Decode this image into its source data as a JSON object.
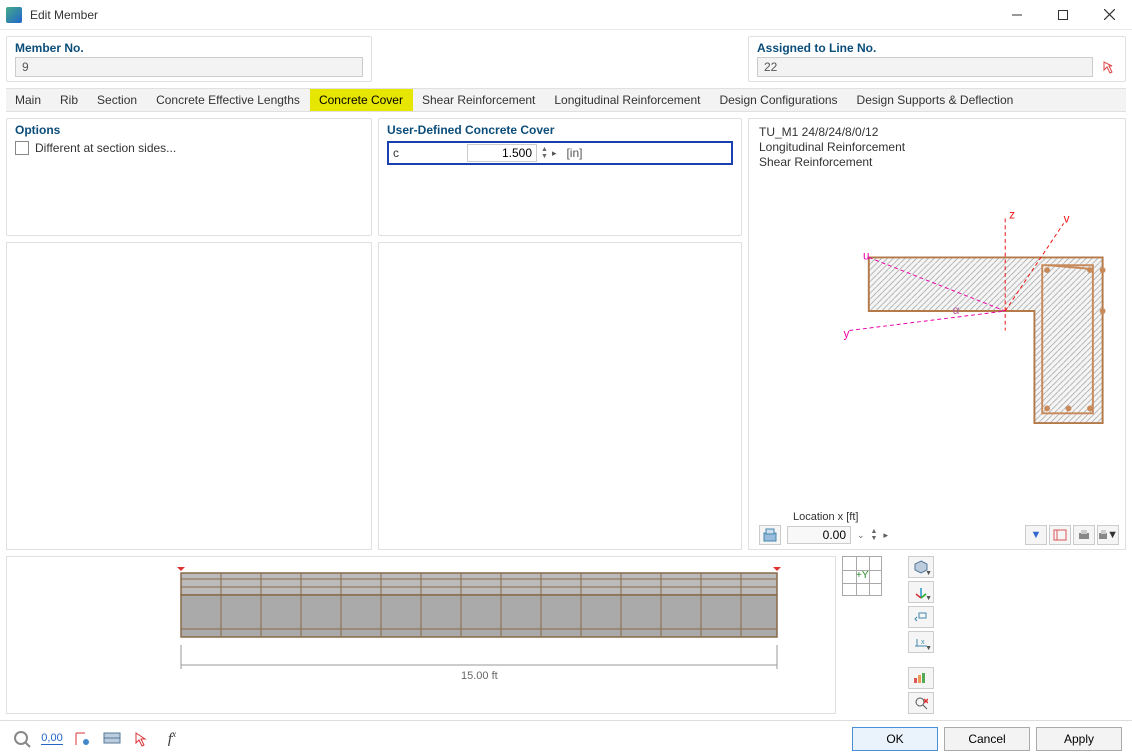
{
  "window": {
    "title": "Edit Member"
  },
  "member_panel": {
    "title": "Member No.",
    "value": "9"
  },
  "assigned_panel": {
    "title": "Assigned to Line No.",
    "value": "22"
  },
  "tabs": [
    "Main",
    "Rib",
    "Section",
    "Concrete Effective Lengths",
    "Concrete Cover",
    "Shear Reinforcement",
    "Longitudinal Reinforcement",
    "Design Configurations",
    "Design Supports & Deflection"
  ],
  "active_tab": "Concrete Cover",
  "options": {
    "title": "Options",
    "different_sides": "Different at section sides..."
  },
  "cover": {
    "title": "User-Defined Concrete Cover",
    "label": "c",
    "value": "1.500",
    "unit": "[in]"
  },
  "preview": {
    "header_lines": [
      "TU_M1 24/8/24/8/0/12",
      "Longitudinal Reinforcement",
      "Shear Reinforcement"
    ],
    "axes": {
      "z": "z",
      "v": "v",
      "u": "u",
      "y": "y",
      "alpha": "α"
    },
    "location_label": "Location x [ft]",
    "location_value": "0.00"
  },
  "beam": {
    "length_label": "15.00 ft"
  },
  "controls": {
    "plus_y": "+Y"
  },
  "footer": {
    "ok": "OK",
    "cancel": "Cancel",
    "apply": "Apply"
  }
}
